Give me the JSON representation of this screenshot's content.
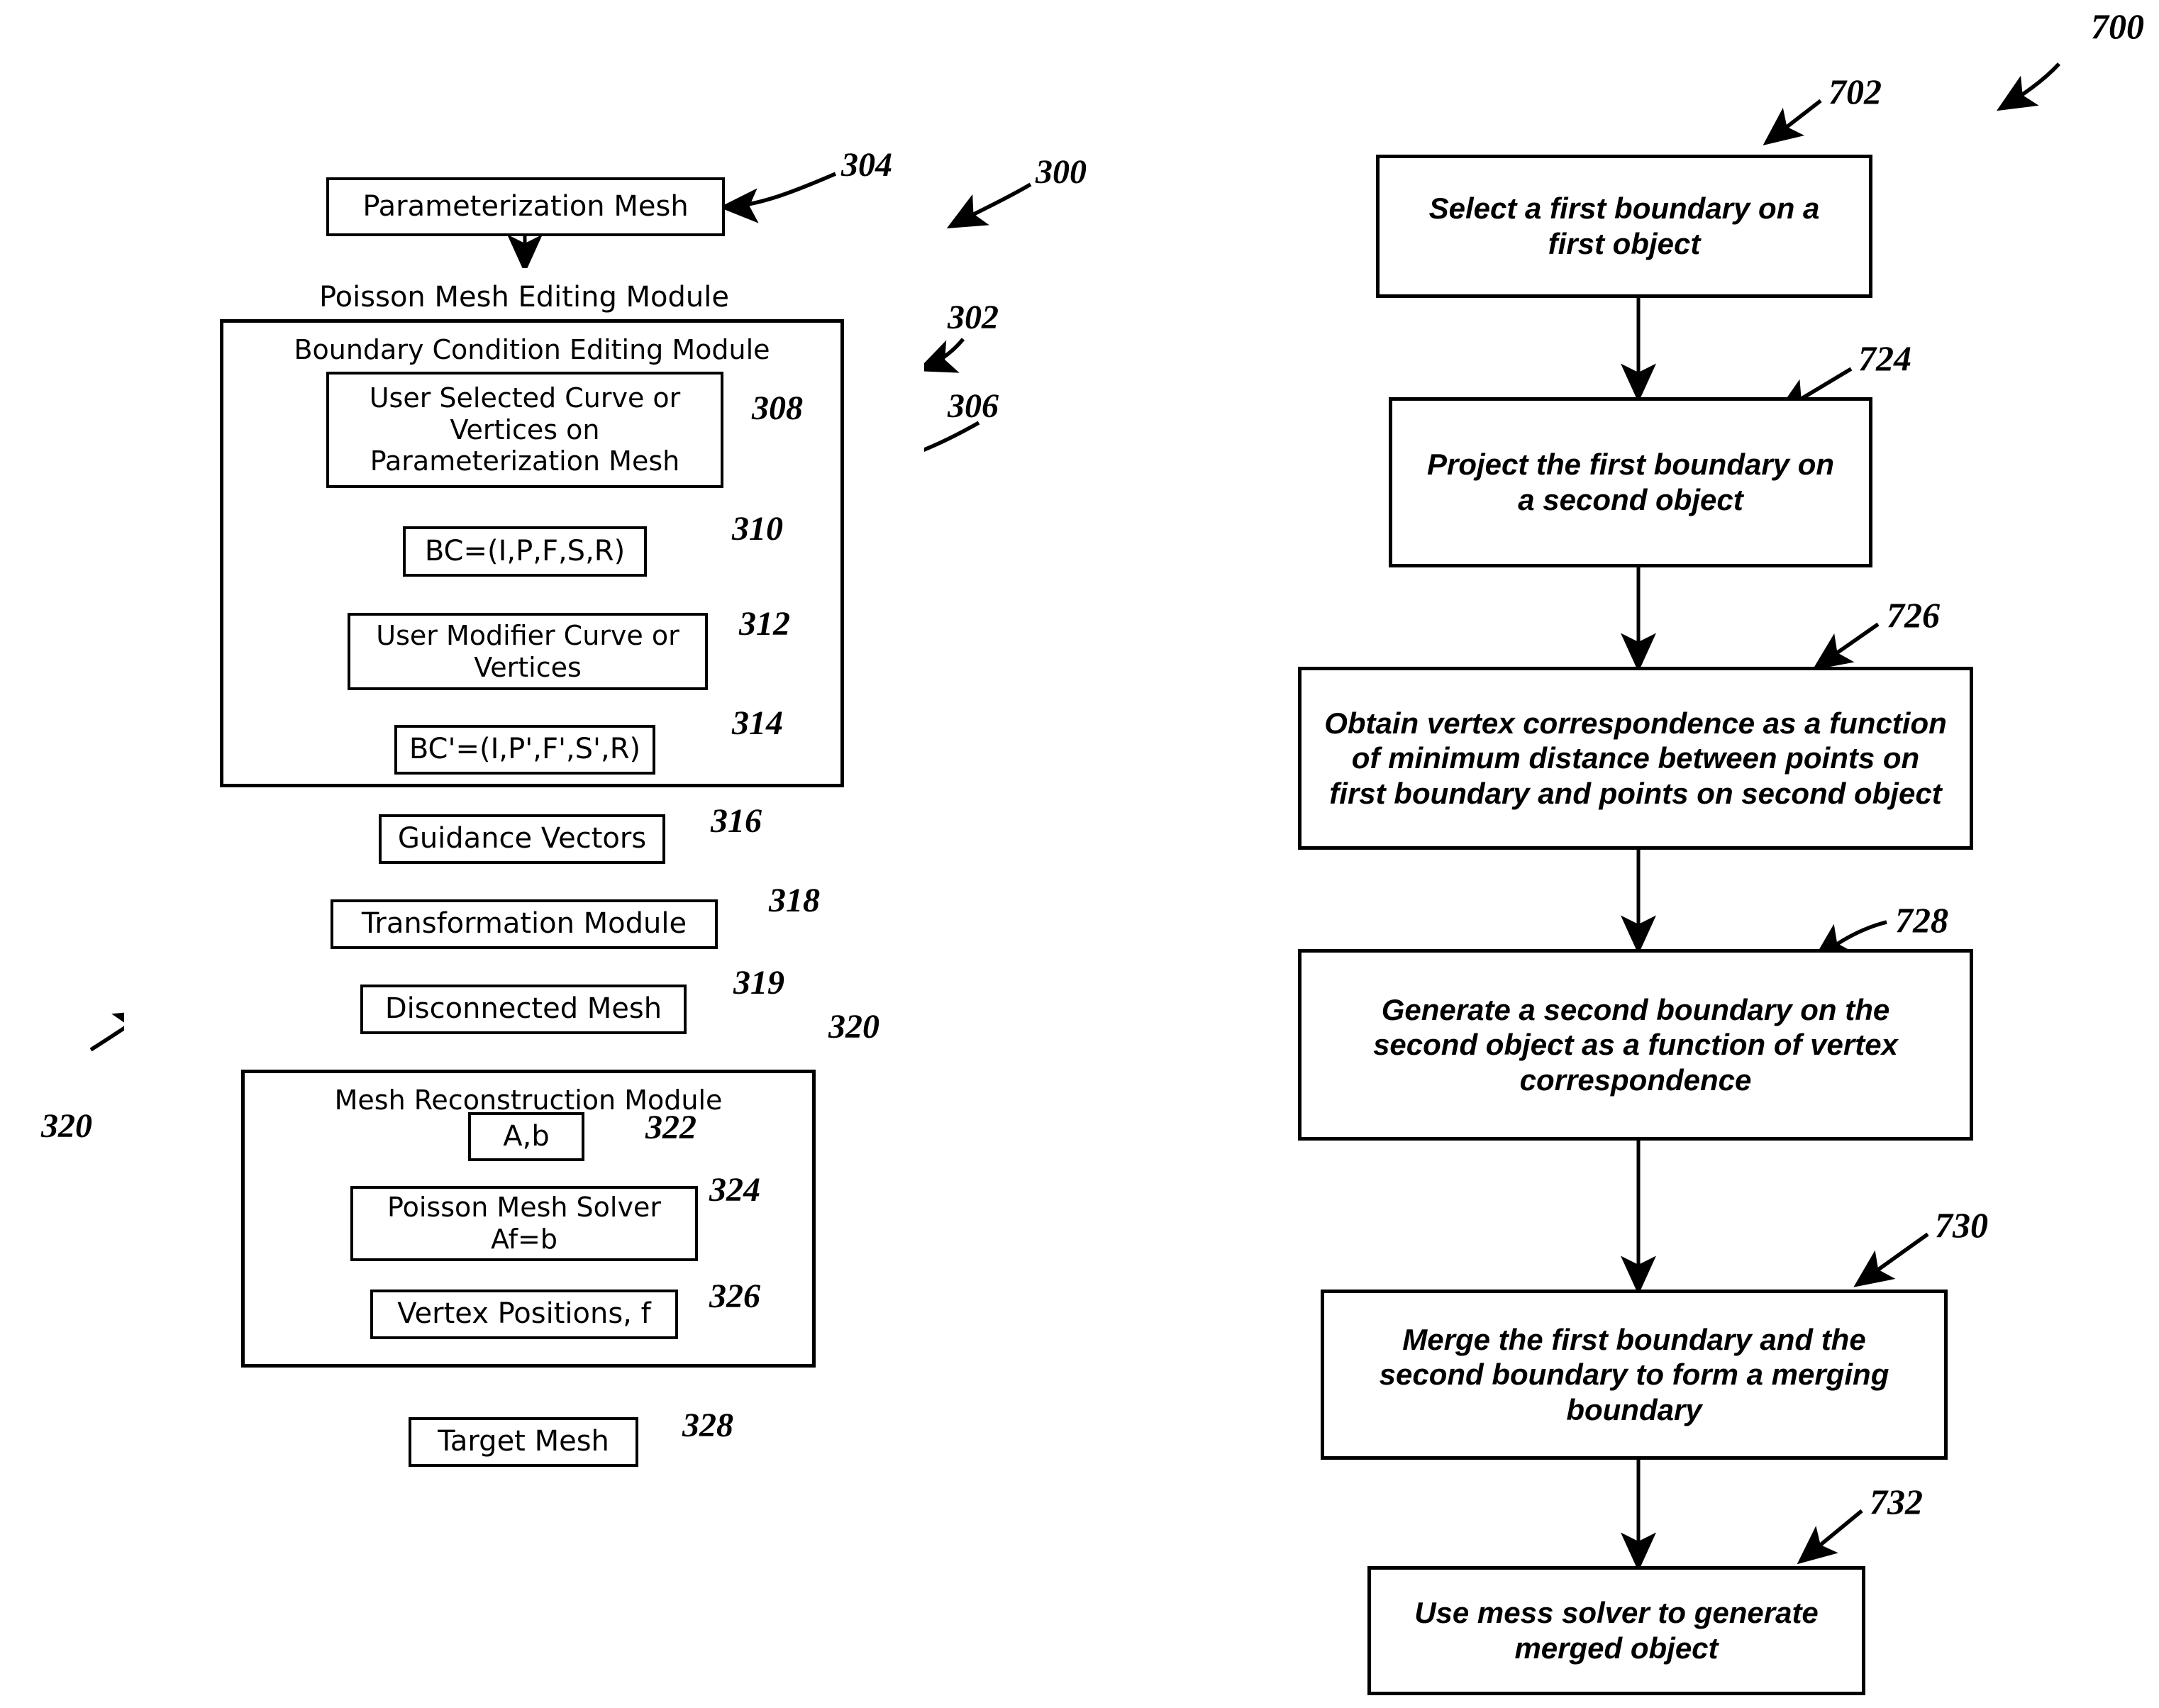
{
  "figure_left": {
    "id_label": "300",
    "nodes": {
      "parameterization_mesh": "Parameterization Mesh",
      "poisson_mesh_editing_module": "Poisson Mesh Editing Module",
      "boundary_condition_editing_module": "Boundary Condition Editing Module",
      "user_selected_curve": "User Selected Curve or Vertices on Parameterization Mesh",
      "bc": "BC=(I,P,F,S,R)",
      "user_modifier_curve": "User Modifier Curve or Vertices",
      "bc_prime": "BC'=(I,P',F',S',R)",
      "guidance_vectors": "Guidance Vectors",
      "transformation_module": "Transformation Module",
      "disconnected_mesh": "Disconnected Mesh",
      "mesh_reconstruction_module": "Mesh Reconstruction Module",
      "a_b": "A,b",
      "poisson_mesh_solver": "Poisson Mesh Solver Af=b",
      "vertex_positions": "Vertex Positions, f",
      "target_mesh": "Target Mesh"
    },
    "refs": {
      "r300": "300",
      "r302": "302",
      "r304": "304",
      "r306": "306",
      "r308": "308",
      "r310": "310",
      "r312": "312",
      "r314": "314",
      "r316": "316",
      "r318": "318",
      "r319": "319",
      "r320_box": "320",
      "r320_loop": "320",
      "r322": "322",
      "r324": "324",
      "r326": "326",
      "r328": "328"
    }
  },
  "figure_right": {
    "id_label": "700",
    "steps": [
      {
        "ref": "702",
        "text": "Select a first boundary on a first object"
      },
      {
        "ref": "724",
        "text": "Project the first boundary on a second object"
      },
      {
        "ref": "726",
        "text": "Obtain vertex correspondence as a function of minimum distance between points on first boundary and points on second object"
      },
      {
        "ref": "728",
        "text": "Generate a second boundary on the second object as a function of vertex correspondence"
      },
      {
        "ref": "730",
        "text": "Merge the first boundary and the second boundary to form a merging boundary"
      },
      {
        "ref": "732",
        "text": "Use mess solver to generate merged object"
      }
    ]
  },
  "colors": {
    "ink": "#000000",
    "paper": "#ffffff"
  }
}
